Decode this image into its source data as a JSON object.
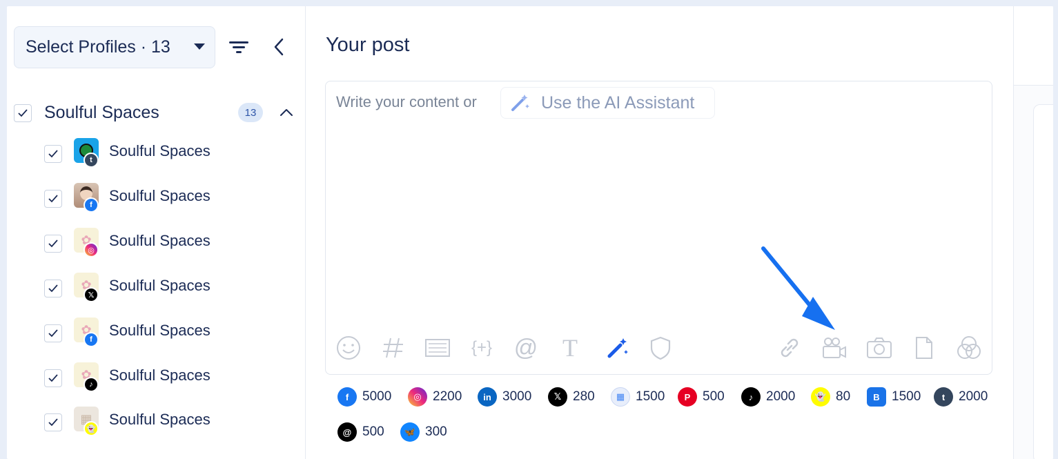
{
  "sidebar": {
    "select_profiles_label": "Select Profiles · 13",
    "group": {
      "name": "Soulful Spaces",
      "count": "13"
    },
    "profiles": [
      {
        "name": "Soulful Spaces",
        "network": "tumblr"
      },
      {
        "name": "Soulful Spaces",
        "network": "facebook"
      },
      {
        "name": "Soulful Spaces",
        "network": "instagram"
      },
      {
        "name": "Soulful Spaces",
        "network": "x"
      },
      {
        "name": "Soulful Spaces",
        "network": "facebook"
      },
      {
        "name": "Soulful Spaces",
        "network": "tiktok"
      },
      {
        "name": "Soulful Spaces",
        "network": "snapchat"
      }
    ]
  },
  "main": {
    "title": "Your post",
    "placeholder": "Write your content or",
    "ai_assistant_label": "Use the AI Assistant"
  },
  "limits": [
    {
      "network": "facebook",
      "value": "5000",
      "color": "#1877f2"
    },
    {
      "network": "instagram",
      "value": "2200",
      "color": "#d62976"
    },
    {
      "network": "linkedin",
      "value": "3000",
      "color": "#0a66c2"
    },
    {
      "network": "x",
      "value": "280",
      "color": "#000000"
    },
    {
      "network": "google-business",
      "value": "1500",
      "color": "#4285f4"
    },
    {
      "network": "pinterest",
      "value": "500",
      "color": "#e60023"
    },
    {
      "network": "tiktok",
      "value": "2000",
      "color": "#000000"
    },
    {
      "network": "snapchat",
      "value": "80",
      "color": "#fffc00"
    },
    {
      "network": "blogger",
      "value": "1500",
      "color": "#1a73e8"
    },
    {
      "network": "tumblr",
      "value": "2000",
      "color": "#34465d"
    },
    {
      "network": "threads",
      "value": "500",
      "color": "#000000"
    },
    {
      "network": "bluesky",
      "value": "300",
      "color": "#1185fe"
    }
  ]
}
